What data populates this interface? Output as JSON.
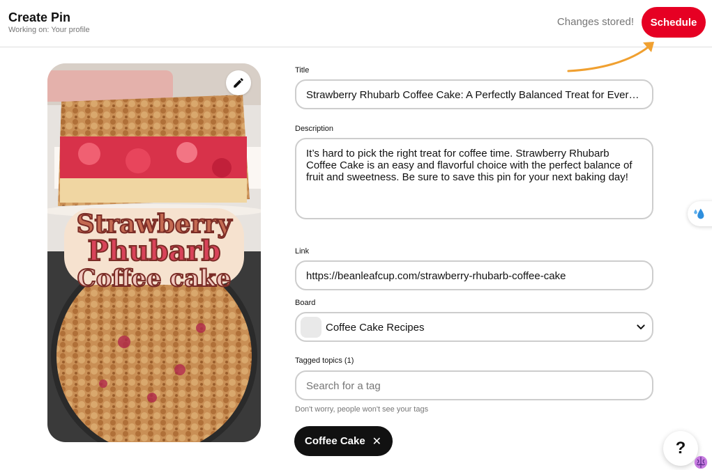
{
  "header": {
    "title": "Create Pin",
    "subtitle": "Working on: Your profile",
    "status": "Changes stored!",
    "schedule_label": "Schedule"
  },
  "pin_image": {
    "overlay_lines": [
      "Strawberry",
      "Phubarb",
      "Coffee cake"
    ]
  },
  "form": {
    "title_label": "Title",
    "title_value": "Strawberry Rhubarb Coffee Cake: A Perfectly Balanced Treat for Every O...",
    "description_label": "Description",
    "description_value": "It’s hard to pick the right treat for coffee time. Strawberry Rhubarb Coffee Cake is an easy and flavorful choice with the perfect balance of fruit and sweetness. Be sure to save this pin for your next baking day!",
    "link_label": "Link",
    "link_value": "https://beanleafcup.com/strawberry-rhubarb-coffee-cake",
    "board_label": "Board",
    "board_value": "Coffee Cake Recipes",
    "tags_label": "Tagged topics (1)",
    "tags_placeholder": "Search for a tag",
    "tags_help": "Don't worry, people won't see your tags",
    "chip_label": "Coffee Cake",
    "chip_remove": "✕"
  },
  "help_label": "?",
  "colors": {
    "brand": "#e60023",
    "annotation_arrow": "#f0a030",
    "chip_bg": "#111111",
    "border": "#cdcdcd",
    "muted_text": "#767676"
  },
  "icons": {
    "edit": "pencil-icon",
    "board_dropdown": "chevron-down-icon",
    "chip_remove": "close-icon",
    "side_widget": "water-drops-icon",
    "help": "question-mark-icon",
    "brain": "brain-icon"
  }
}
